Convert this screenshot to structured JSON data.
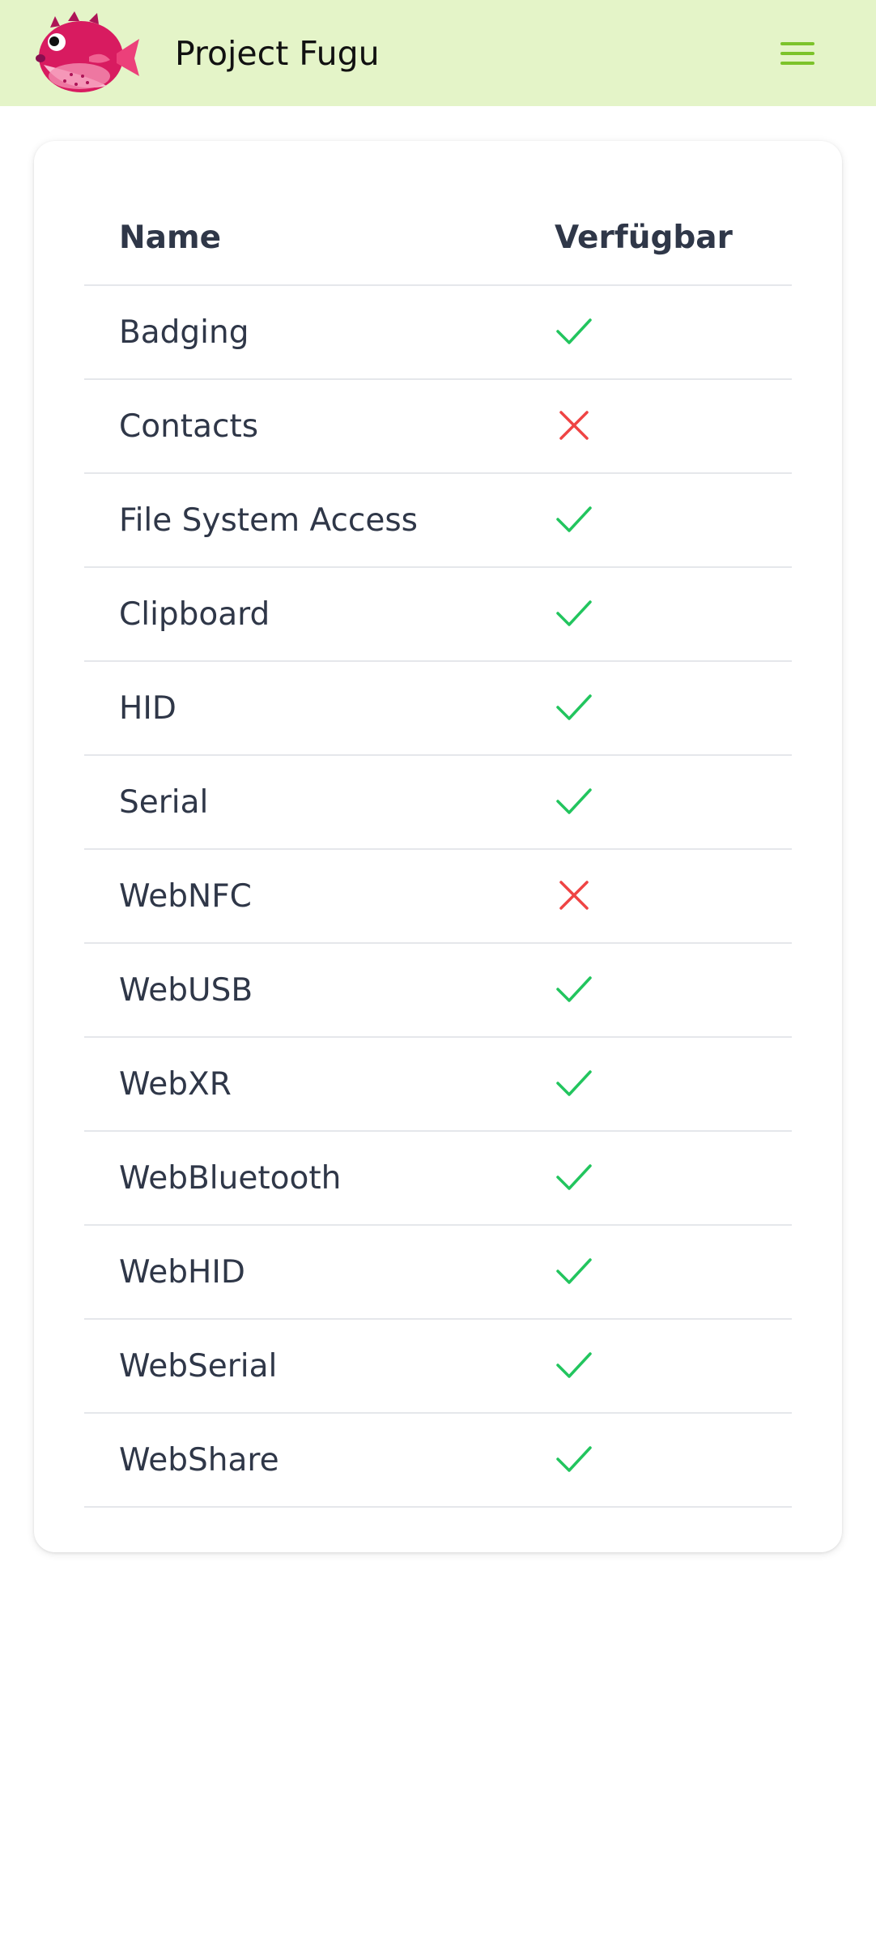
{
  "header": {
    "title": "Project Fugu",
    "logo_icon": "pufferfish-logo-icon",
    "menu_icon": "hamburger-menu-icon",
    "background_color": "#e4f4c8",
    "accent_color": "#7cc32a"
  },
  "table": {
    "columns": [
      "Name",
      "Verfügbar"
    ],
    "rows": [
      {
        "name": "Badging",
        "available": true
      },
      {
        "name": "Contacts",
        "available": false
      },
      {
        "name": "File System Access",
        "available": true
      },
      {
        "name": "Clipboard",
        "available": true
      },
      {
        "name": "HID",
        "available": true
      },
      {
        "name": "Serial",
        "available": true
      },
      {
        "name": "WebNFC",
        "available": false
      },
      {
        "name": "WebUSB",
        "available": true
      },
      {
        "name": "WebXR",
        "available": true
      },
      {
        "name": "WebBluetooth",
        "available": true
      },
      {
        "name": "WebHID",
        "available": true
      },
      {
        "name": "WebSerial",
        "available": true
      },
      {
        "name": "WebShare",
        "available": true
      }
    ],
    "available_icon": "check-icon",
    "unavailable_icon": "cross-icon",
    "available_color": "#22c55e",
    "unavailable_color": "#ef4444"
  }
}
